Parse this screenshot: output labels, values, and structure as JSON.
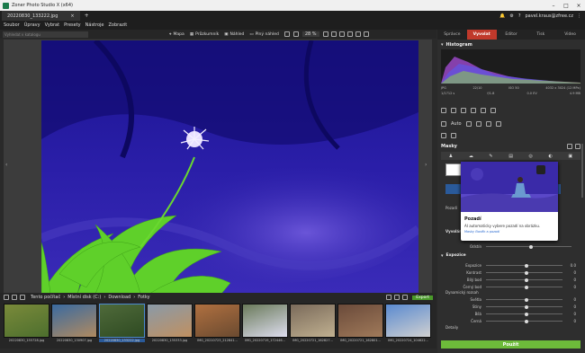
{
  "window": {
    "app_title": "Zoner Photo Studio X (x64)",
    "tab_title": "20220830_133222.jpg",
    "new_tab": "+",
    "user": "pavel.kraus@zfree.cz"
  },
  "menu": [
    "Soubor",
    "Úpravy",
    "Vybrat",
    "Presety",
    "Nástroje",
    "Zobrazit"
  ],
  "toolbar": {
    "search_placeholder": "Vyhledat v katalogu",
    "map": "Mapa",
    "compare": "Průzkumník",
    "preview": "Náhled",
    "fullscreen": "Plný náhled",
    "zoom": "28 %"
  },
  "filmstrip_toolbar": {
    "breadcrumb": [
      "Tento počítač",
      "Místní disk (C:)",
      "Download",
      "Fotky"
    ],
    "export": "Export"
  },
  "thumbs": [
    {
      "label": "20220830_155728.jpg",
      "colors": [
        "#7a8a3a",
        "#4d6f2e"
      ]
    },
    {
      "label": "20220830_130907.jpg",
      "colors": [
        "#3a6aa0",
        "#b08a60"
      ]
    },
    {
      "label": "20220830_133222.jpg",
      "colors": [
        "#4f6a3a",
        "#2e4a22"
      ]
    },
    {
      "label": "20220830_135333.jpg",
      "colors": [
        "#8a9aa8",
        "#c09060"
      ]
    },
    {
      "label": "IMG_20210723_212841...",
      "colors": [
        "#b07040",
        "#6a4a30"
      ]
    },
    {
      "label": "IMG_20220719_172446...",
      "colors": [
        "#6a7a5a",
        "#dde"
      ]
    },
    {
      "label": "IMG_20220721_162827...",
      "colors": [
        "#7a6a5a",
        "#c0b090"
      ]
    },
    {
      "label": "IMG_20220721_162801...",
      "colors": [
        "#6a4a3a",
        "#a07a5a"
      ]
    },
    {
      "label": "IMG_20220724_104622...",
      "colors": [
        "#5a8ad0",
        "#d0d0d0"
      ]
    }
  ],
  "sidebar": {
    "modes": [
      "Správce",
      "Vyvolat",
      "Editor",
      "Tisk",
      "Video"
    ],
    "active_mode": "Vyvolat",
    "histogram_title": "Histogram",
    "exif": {
      "format": "JPG",
      "ratio": "22/10",
      "iso": "ISO 50",
      "resolution": "4032 x 3024 (12 MPx)",
      "shutter": "1/1712 s",
      "aperture": "f/1.8",
      "focal": "0.0 EV",
      "size": "4.9 MB"
    },
    "auto_label": "Auto",
    "masks_title": "Masky",
    "mask_rows": [
      {
        "label": "Pozadí"
      },
      {
        "label": "Vyvolání"
      }
    ],
    "background_label": "Pozadí",
    "develop_label": "Vyvolání",
    "sharpen_label": "Odstín",
    "exposure_title": "Expozice",
    "exposure_rows": [
      {
        "label": "Expozice",
        "value": "0.0",
        "pos": 0.5
      },
      {
        "label": "Kontrast",
        "value": "0",
        "pos": 0.5
      },
      {
        "label": "Bílý bod",
        "value": "0",
        "pos": 0.5
      },
      {
        "label": "Černý bod",
        "value": "0",
        "pos": 0.5
      }
    ],
    "dynamic_title": "Dynamický rozsah",
    "dynamic_rows": [
      {
        "label": "Světla",
        "value": "0",
        "pos": 0.5
      },
      {
        "label": "Stíny",
        "value": "0",
        "pos": 0.5
      },
      {
        "label": "Bílá",
        "value": "0",
        "pos": 0.5
      },
      {
        "label": "Černá",
        "value": "0",
        "pos": 0.5
      }
    ],
    "details_title": "Detaily",
    "apply": "Použít"
  },
  "popup": {
    "title": "Pozadí",
    "text": "AI automaticky vybere pozadí na obrázku.",
    "link": "Masky člověk a pozadí"
  },
  "colors": {
    "accent": "#c0392b",
    "apply": "#6dbb3a",
    "overlay": "#3a2bd0"
  }
}
